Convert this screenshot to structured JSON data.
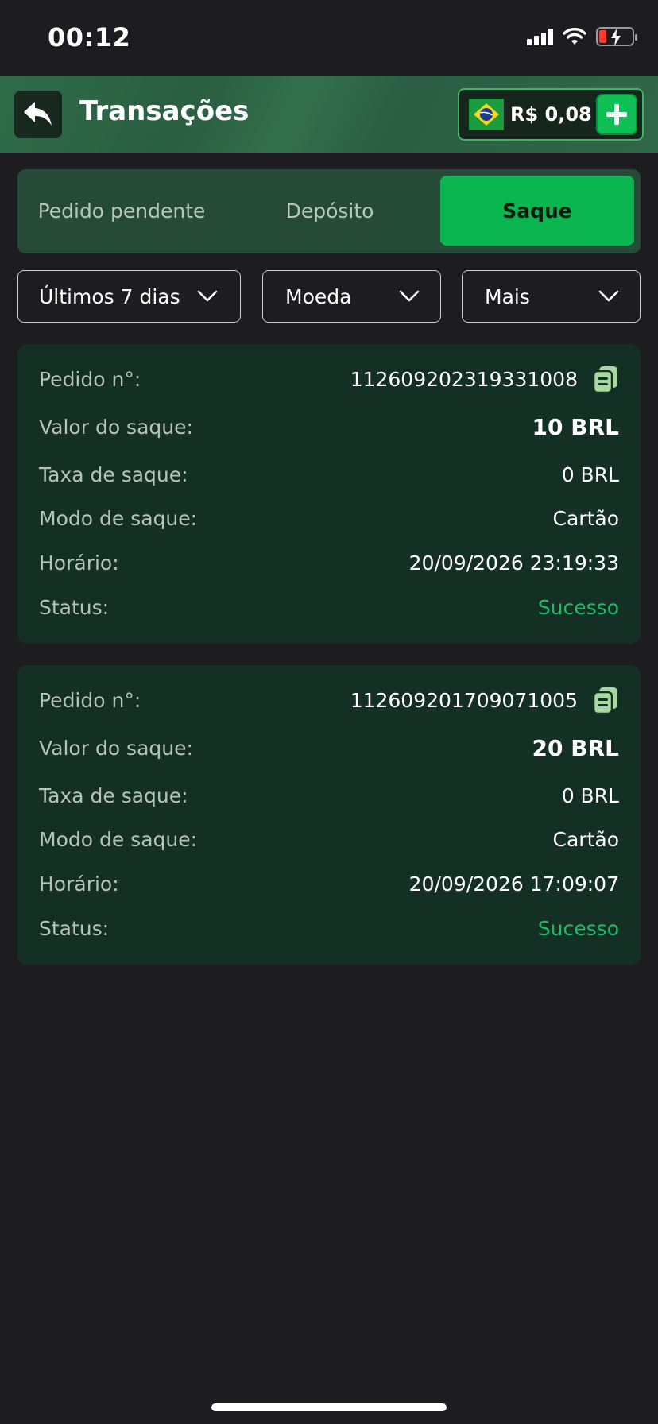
{
  "status_bar": {
    "time": "00:12",
    "icons": [
      "signal-icon",
      "wifi-icon",
      "battery-charging-icon"
    ],
    "battery_color": "#ff3b30"
  },
  "header": {
    "back_icon": "back-arrow-icon",
    "title": "Transações",
    "wallet": {
      "currency_flag": "brazil-flag-icon",
      "balance": "R$ 0,08",
      "add_icon": "plus-icon"
    }
  },
  "tabs": [
    {
      "label": "Pedido pendente",
      "active": false
    },
    {
      "label": "Depósito",
      "active": false
    },
    {
      "label": "Saque",
      "active": true
    }
  ],
  "filters": [
    {
      "label": "Últimos 7 dias"
    },
    {
      "label": "Moeda"
    },
    {
      "label": "Mais"
    }
  ],
  "labels": {
    "order_no": "Pedido n°:",
    "amount": "Valor do saque:",
    "fee": "Taxa de saque:",
    "mode": "Modo de saque:",
    "time": "Horário:",
    "status": "Status:"
  },
  "transactions": [
    {
      "order_no": "112609202319331008",
      "amount": "10 BRL",
      "fee": "0 BRL",
      "mode": "Cartão",
      "time": "20/09/2026 23:19:33",
      "status": "Sucesso"
    },
    {
      "order_no": "112609201709071005",
      "amount": "20 BRL",
      "fee": "0 BRL",
      "mode": "Cartão",
      "time": "20/09/2026 17:09:07",
      "status": "Sucesso"
    }
  ],
  "colors": {
    "accent": "#0bb651",
    "success": "#22b968",
    "card_bg": "#143024",
    "header_bg": "#2e6b49"
  }
}
